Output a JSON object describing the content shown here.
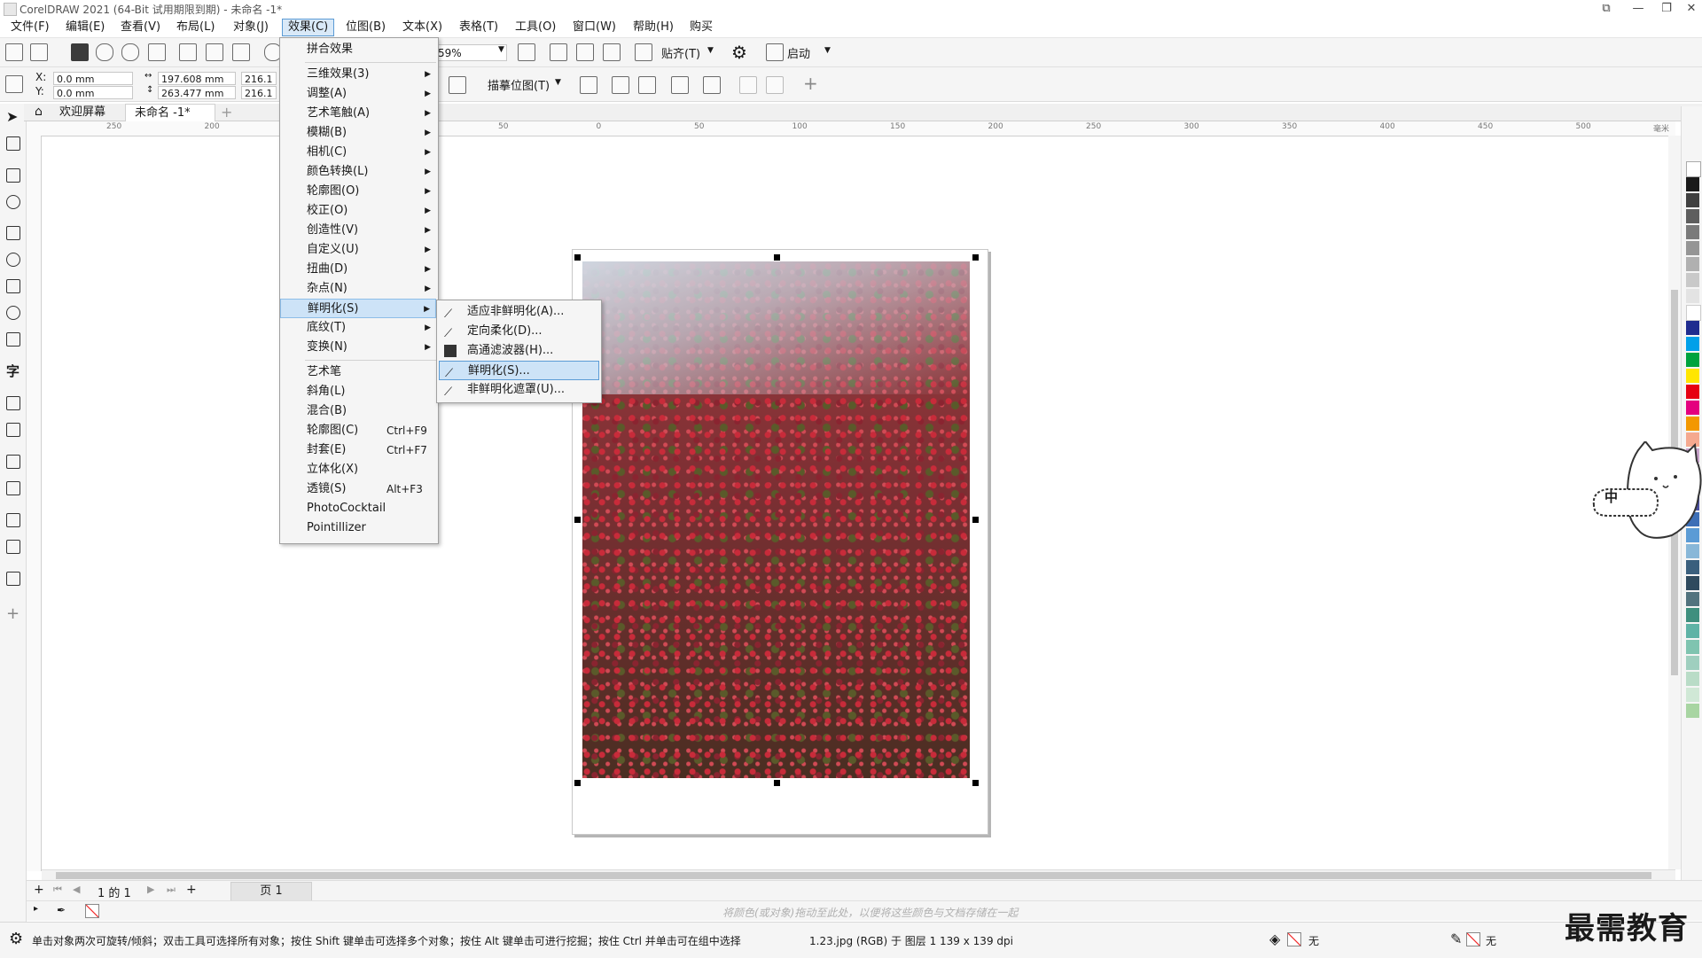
{
  "window": {
    "title": "CorelDRAW 2021 (64-Bit 试用期限到期) - 未命名 -1*"
  },
  "menubar": [
    {
      "label": "文件(F)"
    },
    {
      "label": "编辑(E)"
    },
    {
      "label": "查看(V)"
    },
    {
      "label": "布局(L)"
    },
    {
      "label": "对象(J)"
    },
    {
      "label": "效果(C)",
      "active": true
    },
    {
      "label": "位图(B)"
    },
    {
      "label": "文本(X)"
    },
    {
      "label": "表格(T)"
    },
    {
      "label": "工具(O)"
    },
    {
      "label": "窗口(W)"
    },
    {
      "label": "帮助(H)"
    },
    {
      "label": "购买"
    }
  ],
  "toolbar": {
    "zoom_value": "59%",
    "snap_label": "贴齐(T)",
    "launch_label": "启动"
  },
  "propbar": {
    "x_label": "X:",
    "x_value": "0.0 mm",
    "y_label": "Y:",
    "y_value": "0.0 mm",
    "width_value": "197.608 mm",
    "height_value": "263.477 mm",
    "scale_w": "216.1",
    "scale_h": "216.1",
    "trace_label": "描摹位图(T)"
  },
  "tabs": {
    "welcome": "欢迎屏幕",
    "document": "未命名 -1*"
  },
  "ruler": {
    "h_ticks": [
      "250",
      "200",
      "150",
      "100",
      "50",
      "0",
      "50",
      "100",
      "150",
      "200",
      "250",
      "300",
      "350",
      "400",
      "450",
      "500"
    ],
    "unit": "毫米"
  },
  "effects_menu": {
    "items": [
      {
        "label": "拼合效果"
      },
      {
        "label": "三维效果(3)",
        "sub": true
      },
      {
        "label": "调整(A)",
        "sub": true
      },
      {
        "label": "艺术笔触(A)",
        "sub": true
      },
      {
        "label": "模糊(B)",
        "sub": true
      },
      {
        "label": "相机(C)",
        "sub": true
      },
      {
        "label": "颜色转换(L)",
        "sub": true
      },
      {
        "label": "轮廓图(O)",
        "sub": true
      },
      {
        "label": "校正(O)",
        "sub": true
      },
      {
        "label": "创造性(V)",
        "sub": true
      },
      {
        "label": "自定义(U)",
        "sub": true
      },
      {
        "label": "扭曲(D)",
        "sub": true
      },
      {
        "label": "杂点(N)",
        "sub": true
      },
      {
        "label": "鲜明化(S)",
        "sub": true,
        "highlighted": true
      },
      {
        "label": "底纹(T)",
        "sub": true
      },
      {
        "label": "变换(N)",
        "sub": true
      },
      {
        "label": "艺术笔"
      },
      {
        "label": "斜角(L)"
      },
      {
        "label": "混合(B)"
      },
      {
        "label": "轮廓图(C)",
        "shortcut": "Ctrl+F9"
      },
      {
        "label": "封套(E)",
        "shortcut": "Ctrl+F7"
      },
      {
        "label": "立体化(X)"
      },
      {
        "label": "透镜(S)",
        "shortcut": "Alt+F3"
      },
      {
        "label": "PhotoCocktail"
      },
      {
        "label": "Pointillizer"
      }
    ]
  },
  "sharpen_submenu": {
    "items": [
      {
        "label": "适应非鲜明化(A)...",
        "icon": "adaptive-unsharp-icon"
      },
      {
        "label": "定向柔化(D)...",
        "icon": "directional-smooth-icon"
      },
      {
        "label": "高通滤波器(H)...",
        "icon": "high-pass-icon"
      },
      {
        "label": "鲜明化(S)...",
        "icon": "sharpen-icon",
        "highlighted": true
      },
      {
        "label": "非鲜明化遮罩(U)...",
        "icon": "unsharp-mask-icon"
      }
    ]
  },
  "pagenav": {
    "page_count_text": "1 的 1",
    "page_tab": "页 1"
  },
  "colorbar": {
    "hint": "将颜色(或对象)拖动至此处，以便将这些颜色与文档存储在一起"
  },
  "status": {
    "hint": "单击对象两次可旋转/倾斜；双击工具可选择所有对象；按住 Shift 键单击可选择多个对象；按住 Alt 键单击可进行挖掘；按住 Ctrl 并单击可在组中选择",
    "object_info": "1.23.jpg (RGB) 于 图层 1 139 x 139 dpi",
    "fill_label": "无",
    "outline_label": "无"
  },
  "mascot": {
    "ime_text": "中"
  },
  "watermark": {
    "text": "最需教育"
  },
  "colors": {
    "accent": "#5b9bd5",
    "menu_highlight": "#cde3f7"
  }
}
